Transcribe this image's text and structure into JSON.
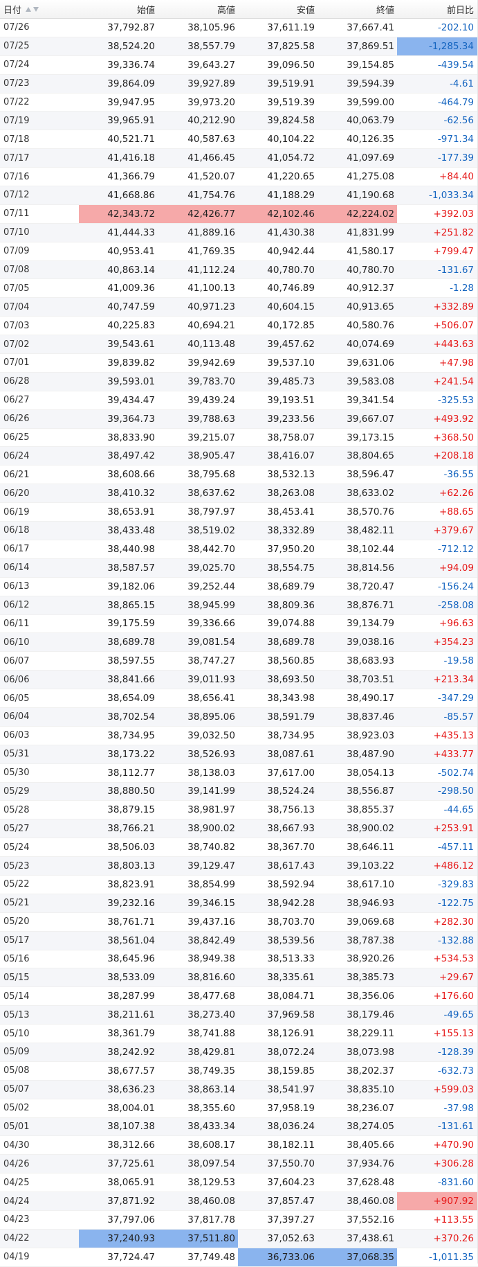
{
  "header": {
    "date_label": "日付",
    "open_label": "始値",
    "high_label": "高値",
    "low_label": "安値",
    "close_label": "終値",
    "change_label": "前日比"
  },
  "rows": [
    {
      "date": "07/26",
      "open": "37,792.87",
      "high": "38,105.96",
      "low": "37,611.19",
      "close": "37,667.41",
      "change": "-202.10"
    },
    {
      "date": "07/25",
      "open": "38,524.20",
      "high": "38,557.79",
      "low": "37,825.58",
      "close": "37,869.51",
      "change": "-1,285.34",
      "hl": {
        "change": "blue"
      }
    },
    {
      "date": "07/24",
      "open": "39,336.74",
      "high": "39,643.27",
      "low": "39,096.50",
      "close": "39,154.85",
      "change": "-439.54"
    },
    {
      "date": "07/23",
      "open": "39,864.09",
      "high": "39,927.89",
      "low": "39,519.91",
      "close": "39,594.39",
      "change": "-4.61"
    },
    {
      "date": "07/22",
      "open": "39,947.95",
      "high": "39,973.20",
      "low": "39,519.39",
      "close": "39,599.00",
      "change": "-464.79"
    },
    {
      "date": "07/19",
      "open": "39,965.91",
      "high": "40,212.90",
      "low": "39,824.58",
      "close": "40,063.79",
      "change": "-62.56"
    },
    {
      "date": "07/18",
      "open": "40,521.71",
      "high": "40,587.63",
      "low": "40,104.22",
      "close": "40,126.35",
      "change": "-971.34"
    },
    {
      "date": "07/17",
      "open": "41,416.18",
      "high": "41,466.45",
      "low": "41,054.72",
      "close": "41,097.69",
      "change": "-177.39"
    },
    {
      "date": "07/16",
      "open": "41,366.79",
      "high": "41,520.07",
      "low": "41,220.65",
      "close": "41,275.08",
      "change": "+84.40"
    },
    {
      "date": "07/12",
      "open": "41,668.86",
      "high": "41,754.76",
      "low": "41,188.29",
      "close": "41,190.68",
      "change": "-1,033.34"
    },
    {
      "date": "07/11",
      "open": "42,343.72",
      "high": "42,426.77",
      "low": "42,102.46",
      "close": "42,224.02",
      "change": "+392.03",
      "hl": {
        "open": "red",
        "high": "red",
        "low": "red",
        "close": "red"
      }
    },
    {
      "date": "07/10",
      "open": "41,444.33",
      "high": "41,889.16",
      "low": "41,430.38",
      "close": "41,831.99",
      "change": "+251.82"
    },
    {
      "date": "07/09",
      "open": "40,953.41",
      "high": "41,769.35",
      "low": "40,942.44",
      "close": "41,580.17",
      "change": "+799.47"
    },
    {
      "date": "07/08",
      "open": "40,863.14",
      "high": "41,112.24",
      "low": "40,780.70",
      "close": "40,780.70",
      "change": "-131.67"
    },
    {
      "date": "07/05",
      "open": "41,009.36",
      "high": "41,100.13",
      "low": "40,746.89",
      "close": "40,912.37",
      "change": "-1.28"
    },
    {
      "date": "07/04",
      "open": "40,747.59",
      "high": "40,971.23",
      "low": "40,604.15",
      "close": "40,913.65",
      "change": "+332.89"
    },
    {
      "date": "07/03",
      "open": "40,225.83",
      "high": "40,694.21",
      "low": "40,172.85",
      "close": "40,580.76",
      "change": "+506.07"
    },
    {
      "date": "07/02",
      "open": "39,543.61",
      "high": "40,113.48",
      "low": "39,457.62",
      "close": "40,074.69",
      "change": "+443.63"
    },
    {
      "date": "07/01",
      "open": "39,839.82",
      "high": "39,942.69",
      "low": "39,537.10",
      "close": "39,631.06",
      "change": "+47.98"
    },
    {
      "date": "06/28",
      "open": "39,593.01",
      "high": "39,783.70",
      "low": "39,485.73",
      "close": "39,583.08",
      "change": "+241.54"
    },
    {
      "date": "06/27",
      "open": "39,434.47",
      "high": "39,439.24",
      "low": "39,193.51",
      "close": "39,341.54",
      "change": "-325.53"
    },
    {
      "date": "06/26",
      "open": "39,364.73",
      "high": "39,788.63",
      "low": "39,233.56",
      "close": "39,667.07",
      "change": "+493.92"
    },
    {
      "date": "06/25",
      "open": "38,833.90",
      "high": "39,215.07",
      "low": "38,758.07",
      "close": "39,173.15",
      "change": "+368.50"
    },
    {
      "date": "06/24",
      "open": "38,497.42",
      "high": "38,905.47",
      "low": "38,416.07",
      "close": "38,804.65",
      "change": "+208.18"
    },
    {
      "date": "06/21",
      "open": "38,608.66",
      "high": "38,795.68",
      "low": "38,532.13",
      "close": "38,596.47",
      "change": "-36.55"
    },
    {
      "date": "06/20",
      "open": "38,410.32",
      "high": "38,637.62",
      "low": "38,263.08",
      "close": "38,633.02",
      "change": "+62.26"
    },
    {
      "date": "06/19",
      "open": "38,653.91",
      "high": "38,797.97",
      "low": "38,453.41",
      "close": "38,570.76",
      "change": "+88.65"
    },
    {
      "date": "06/18",
      "open": "38,433.48",
      "high": "38,519.02",
      "low": "38,332.89",
      "close": "38,482.11",
      "change": "+379.67"
    },
    {
      "date": "06/17",
      "open": "38,440.98",
      "high": "38,442.70",
      "low": "37,950.20",
      "close": "38,102.44",
      "change": "-712.12"
    },
    {
      "date": "06/14",
      "open": "38,587.57",
      "high": "39,025.70",
      "low": "38,554.75",
      "close": "38,814.56",
      "change": "+94.09"
    },
    {
      "date": "06/13",
      "open": "39,182.06",
      "high": "39,252.44",
      "low": "38,689.79",
      "close": "38,720.47",
      "change": "-156.24"
    },
    {
      "date": "06/12",
      "open": "38,865.15",
      "high": "38,945.99",
      "low": "38,809.36",
      "close": "38,876.71",
      "change": "-258.08"
    },
    {
      "date": "06/11",
      "open": "39,175.59",
      "high": "39,336.66",
      "low": "39,074.88",
      "close": "39,134.79",
      "change": "+96.63"
    },
    {
      "date": "06/10",
      "open": "38,689.78",
      "high": "39,081.54",
      "low": "38,689.78",
      "close": "39,038.16",
      "change": "+354.23"
    },
    {
      "date": "06/07",
      "open": "38,597.55",
      "high": "38,747.27",
      "low": "38,560.85",
      "close": "38,683.93",
      "change": "-19.58"
    },
    {
      "date": "06/06",
      "open": "38,841.66",
      "high": "39,011.93",
      "low": "38,693.50",
      "close": "38,703.51",
      "change": "+213.34"
    },
    {
      "date": "06/05",
      "open": "38,654.09",
      "high": "38,656.41",
      "low": "38,343.98",
      "close": "38,490.17",
      "change": "-347.29"
    },
    {
      "date": "06/04",
      "open": "38,702.54",
      "high": "38,895.06",
      "low": "38,591.79",
      "close": "38,837.46",
      "change": "-85.57"
    },
    {
      "date": "06/03",
      "open": "38,734.95",
      "high": "39,032.50",
      "low": "38,734.95",
      "close": "38,923.03",
      "change": "+435.13"
    },
    {
      "date": "05/31",
      "open": "38,173.22",
      "high": "38,526.93",
      "low": "38,087.61",
      "close": "38,487.90",
      "change": "+433.77"
    },
    {
      "date": "05/30",
      "open": "38,112.77",
      "high": "38,138.03",
      "low": "37,617.00",
      "close": "38,054.13",
      "change": "-502.74"
    },
    {
      "date": "05/29",
      "open": "38,880.50",
      "high": "39,141.99",
      "low": "38,524.24",
      "close": "38,556.87",
      "change": "-298.50"
    },
    {
      "date": "05/28",
      "open": "38,879.15",
      "high": "38,981.97",
      "low": "38,756.13",
      "close": "38,855.37",
      "change": "-44.65"
    },
    {
      "date": "05/27",
      "open": "38,766.21",
      "high": "38,900.02",
      "low": "38,667.93",
      "close": "38,900.02",
      "change": "+253.91"
    },
    {
      "date": "05/24",
      "open": "38,506.03",
      "high": "38,740.82",
      "low": "38,367.70",
      "close": "38,646.11",
      "change": "-457.11"
    },
    {
      "date": "05/23",
      "open": "38,803.13",
      "high": "39,129.47",
      "low": "38,617.43",
      "close": "39,103.22",
      "change": "+486.12"
    },
    {
      "date": "05/22",
      "open": "38,823.91",
      "high": "38,854.99",
      "low": "38,592.94",
      "close": "38,617.10",
      "change": "-329.83"
    },
    {
      "date": "05/21",
      "open": "39,232.16",
      "high": "39,346.15",
      "low": "38,942.28",
      "close": "38,946.93",
      "change": "-122.75"
    },
    {
      "date": "05/20",
      "open": "38,761.71",
      "high": "39,437.16",
      "low": "38,703.70",
      "close": "39,069.68",
      "change": "+282.30"
    },
    {
      "date": "05/17",
      "open": "38,561.04",
      "high": "38,842.49",
      "low": "38,539.56",
      "close": "38,787.38",
      "change": "-132.88"
    },
    {
      "date": "05/16",
      "open": "38,645.96",
      "high": "38,949.38",
      "low": "38,513.33",
      "close": "38,920.26",
      "change": "+534.53"
    },
    {
      "date": "05/15",
      "open": "38,533.09",
      "high": "38,816.60",
      "low": "38,335.61",
      "close": "38,385.73",
      "change": "+29.67"
    },
    {
      "date": "05/14",
      "open": "38,287.99",
      "high": "38,477.68",
      "low": "38,084.71",
      "close": "38,356.06",
      "change": "+176.60"
    },
    {
      "date": "05/13",
      "open": "38,211.61",
      "high": "38,273.40",
      "low": "37,969.58",
      "close": "38,179.46",
      "change": "-49.65"
    },
    {
      "date": "05/10",
      "open": "38,361.79",
      "high": "38,741.88",
      "low": "38,126.91",
      "close": "38,229.11",
      "change": "+155.13"
    },
    {
      "date": "05/09",
      "open": "38,242.92",
      "high": "38,429.81",
      "low": "38,072.24",
      "close": "38,073.98",
      "change": "-128.39"
    },
    {
      "date": "05/08",
      "open": "38,677.57",
      "high": "38,749.35",
      "low": "38,159.85",
      "close": "38,202.37",
      "change": "-632.73"
    },
    {
      "date": "05/07",
      "open": "38,636.23",
      "high": "38,863.14",
      "low": "38,541.97",
      "close": "38,835.10",
      "change": "+599.03"
    },
    {
      "date": "05/02",
      "open": "38,004.01",
      "high": "38,355.60",
      "low": "37,958.19",
      "close": "38,236.07",
      "change": "-37.98"
    },
    {
      "date": "05/01",
      "open": "38,107.38",
      "high": "38,433.34",
      "low": "38,036.24",
      "close": "38,274.05",
      "change": "-131.61"
    },
    {
      "date": "04/30",
      "open": "38,312.66",
      "high": "38,608.17",
      "low": "38,182.11",
      "close": "38,405.66",
      "change": "+470.90"
    },
    {
      "date": "04/26",
      "open": "37,725.61",
      "high": "38,097.54",
      "low": "37,550.70",
      "close": "37,934.76",
      "change": "+306.28"
    },
    {
      "date": "04/25",
      "open": "38,065.91",
      "high": "38,129.53",
      "low": "37,604.23",
      "close": "37,628.48",
      "change": "-831.60"
    },
    {
      "date": "04/24",
      "open": "37,871.92",
      "high": "38,460.08",
      "low": "37,857.47",
      "close": "38,460.08",
      "change": "+907.92",
      "hl": {
        "change": "red"
      }
    },
    {
      "date": "04/23",
      "open": "37,797.06",
      "high": "37,817.78",
      "low": "37,397.27",
      "close": "37,552.16",
      "change": "+113.55"
    },
    {
      "date": "04/22",
      "open": "37,240.93",
      "high": "37,511.80",
      "low": "37,052.63",
      "close": "37,438.61",
      "change": "+370.26",
      "hl": {
        "open": "blue",
        "high": "blue"
      }
    },
    {
      "date": "04/19",
      "open": "37,724.47",
      "high": "37,749.48",
      "low": "36,733.06",
      "close": "37,068.35",
      "change": "-1,011.35",
      "hl": {
        "low": "blue",
        "close": "blue"
      }
    }
  ],
  "colors": {
    "positive": "#e61919",
    "negative": "#1565c0",
    "highlight_red": "#f6a9a9",
    "highlight_blue": "#8ab4ee"
  },
  "icons": {
    "sort_asc": "triangle-up",
    "sort_desc": "triangle-down"
  }
}
